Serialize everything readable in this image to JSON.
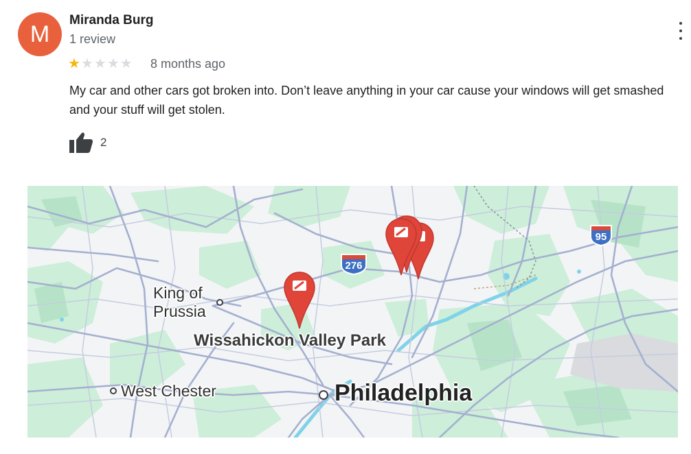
{
  "review": {
    "avatar_initial": "M",
    "avatar_color": "#e8613c",
    "name": "Miranda Burg",
    "review_count": "1 review",
    "rating": 1,
    "rating_max": 5,
    "time": "8 months ago",
    "text": "My car and other cars got broken into. Don’t leave anything in your car cause your windows will get smashed and your stuff will get stolen.",
    "likes": "2",
    "icons": {
      "more": "more-vert-icon",
      "like": "thumb-up-icon",
      "star": "star-icon",
      "pin": "map-pin-icon"
    }
  },
  "map": {
    "labels": {
      "king_of_prussia_line1": "King of",
      "king_of_prussia_line2": "Prussia",
      "wissahickon": "Wissahickon Valley Park",
      "west_chester": "West Chester",
      "philadelphia": "Philadelphia"
    },
    "shields": {
      "i276": "276",
      "i95": "95"
    },
    "colors": {
      "land": "#f3f4f6",
      "park": "#cdeed9",
      "road": "#a4b0cf",
      "water": "#7fd3e8",
      "pin": "#e0453a",
      "shield": "#3d6fc4"
    }
  }
}
